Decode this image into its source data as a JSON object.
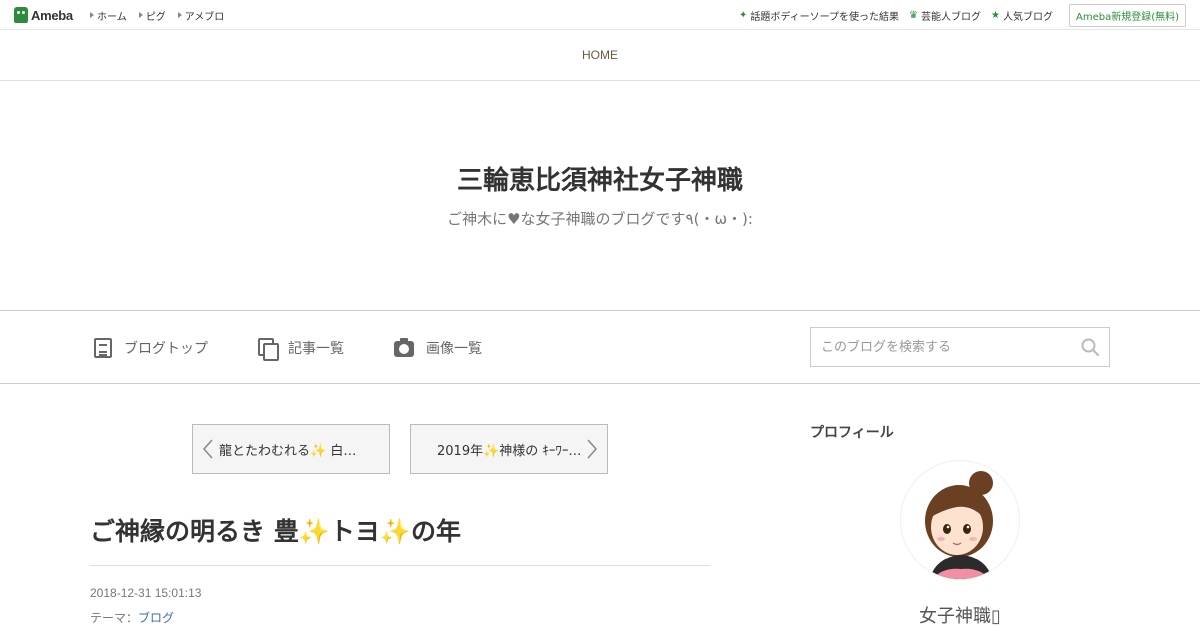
{
  "topbar": {
    "logo_text": "Ameba",
    "nav": [
      "ホーム",
      "ピグ",
      "アメブロ"
    ],
    "right_links": [
      {
        "label": "話題ボディーソープを使った結果",
        "icon": "sparkle-icon"
      },
      {
        "label": "芸能人ブログ",
        "icon": "crown-icon"
      },
      {
        "label": "人気ブログ",
        "icon": "star-icon"
      }
    ],
    "signup_label": "Ameba新規登録(無料)"
  },
  "home_link": "HOME",
  "header": {
    "title": "三輪恵比須神社女子神職",
    "description": "ご神木に♥な女子神職のブログです٩(・ω・):"
  },
  "menu": {
    "items": [
      {
        "label": "ブログトップ",
        "icon": "document-icon"
      },
      {
        "label": "記事一覧",
        "icon": "copy-icon"
      },
      {
        "label": "画像一覧",
        "icon": "camera-icon"
      }
    ],
    "search_placeholder": "このブログを検索する"
  },
  "pager": {
    "prev_label": "龍とたわむれる✨ 白…",
    "next_label": "2019年✨神様の ｷｰﾜｰ…"
  },
  "entry": {
    "title": "ご神縁の明るき 豊✨トヨ✨の年",
    "date": "2018-12-31 15:01:13",
    "theme_prefix": "テーマ：",
    "theme_link": "ブログ"
  },
  "sidebar": {
    "profile_heading": "プロフィール",
    "profile_name": "女子神職▯"
  },
  "colors": {
    "brand_green": "#2d8c3c",
    "home_link": "#6b5a3e",
    "link_blue": "#3a6fb0"
  }
}
